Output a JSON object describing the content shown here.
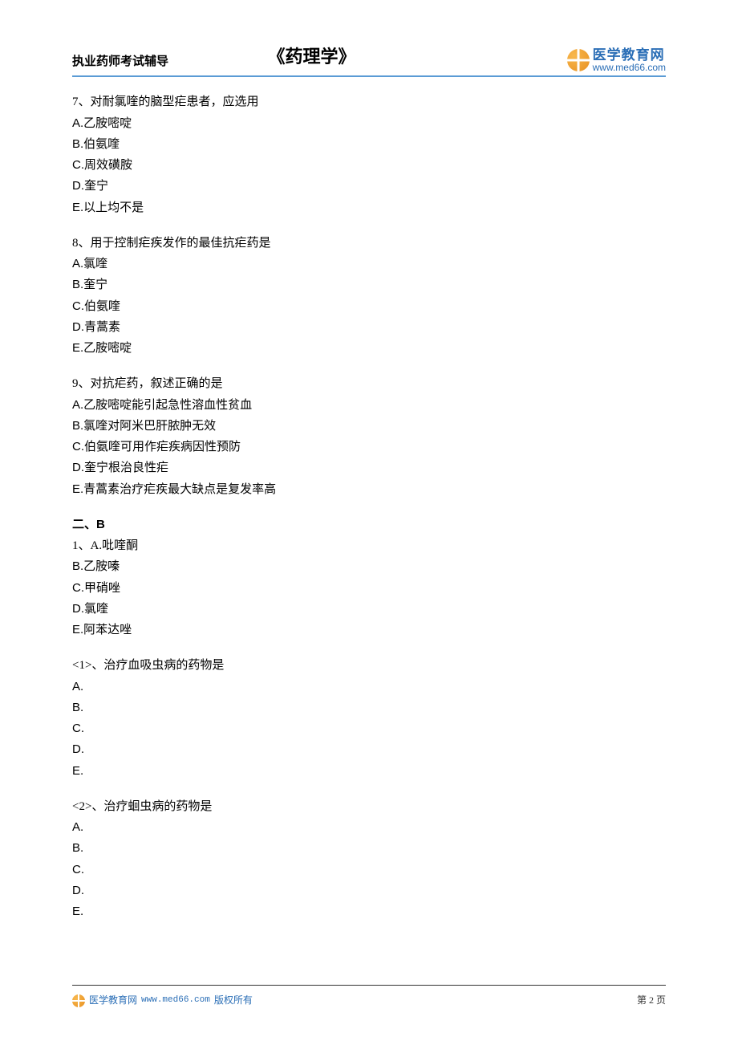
{
  "header": {
    "left_text": "执业药师考试辅导",
    "title": "《药理学》",
    "logo_cn": "医学教育网",
    "logo_url": "www.med66.com"
  },
  "questions": [
    {
      "stem": "7、对耐氯喹的脑型疟患者，应选用",
      "options": [
        "A.乙胺嘧啶",
        "B.伯氨喹",
        "C.周效磺胺",
        "D.奎宁",
        "E.以上均不是"
      ]
    },
    {
      "stem": "8、用于控制疟疾发作的最佳抗疟药是",
      "options": [
        "A.氯喹",
        "B.奎宁",
        "C.伯氨喹",
        "D.青蒿素",
        "E.乙胺嘧啶"
      ]
    },
    {
      "stem": "9、对抗疟药，叙述正确的是",
      "options": [
        "A.乙胺嘧啶能引起急性溶血性贫血",
        "B.氯喹对阿米巴肝脓肿无效",
        "C.伯氨喹可用作疟疾病因性预防",
        "D.奎宁根治良性疟",
        "E.青蒿素治疗疟疾最大缺点是复发率高"
      ]
    }
  ],
  "section_b": {
    "heading": "二、B",
    "shared": {
      "stem": "1、A.吡喹酮",
      "options": [
        "B.乙胺嗪",
        "C.甲硝唑",
        "D.氯喹",
        "E.阿苯达唑"
      ]
    },
    "subquestions": [
      {
        "stem": "<1>、治疗血吸虫病的药物是",
        "options": [
          "A.",
          "B.",
          "C.",
          "D.",
          "E."
        ]
      },
      {
        "stem": "<2>、治疗蛔虫病的药物是",
        "options": [
          "A.",
          "B.",
          "C.",
          "D.",
          "E."
        ]
      }
    ]
  },
  "footer": {
    "brand": "医学教育网",
    "url": "www.med66.com",
    "copyright": "版权所有",
    "page": "第 2 页"
  }
}
